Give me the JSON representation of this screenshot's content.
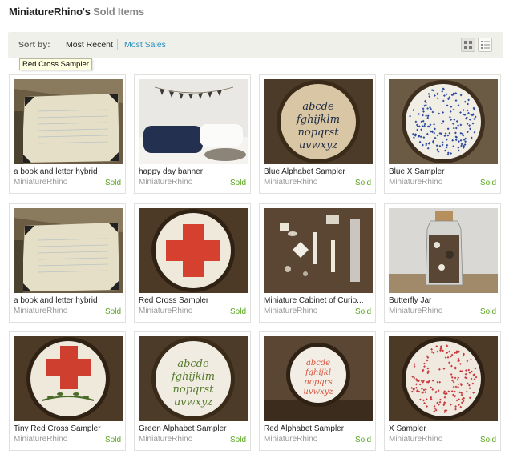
{
  "header": {
    "shop_name": "MiniatureRhino's",
    "suffix": "Sold Items"
  },
  "sortbar": {
    "label": "Sort by:",
    "options": [
      "Most Recent",
      "Most Sales"
    ],
    "active": "Most Recent"
  },
  "tooltip": "Red Cross Sampler",
  "items": [
    {
      "title": "a book and letter hybrid",
      "shop": "MiniatureRhino",
      "status": "Sold",
      "image": "book"
    },
    {
      "title": "happy day banner",
      "shop": "MiniatureRhino",
      "status": "Sold",
      "image": "banner"
    },
    {
      "title": "Blue Alphabet Sampler",
      "shop": "MiniatureRhino",
      "status": "Sold",
      "image": "alphabet-white"
    },
    {
      "title": "Blue X Sampler",
      "shop": "MiniatureRhino",
      "status": "Sold",
      "image": "x-blue"
    },
    {
      "title": "a book and letter hybrid",
      "shop": "MiniatureRhino",
      "status": "Sold",
      "image": "book"
    },
    {
      "title": "Red Cross Sampler",
      "shop": "MiniatureRhino",
      "status": "Sold",
      "image": "cross"
    },
    {
      "title": "Miniature Cabinet of Curio...",
      "shop": "MiniatureRhino",
      "status": "Sold",
      "image": "cabinet"
    },
    {
      "title": "Butterfly Jar",
      "shop": "MiniatureRhino",
      "status": "Sold",
      "image": "jar"
    },
    {
      "title": "Tiny Red Cross Sampler",
      "shop": "MiniatureRhino",
      "status": "Sold",
      "image": "cross-leaves"
    },
    {
      "title": "Green Alphabet Sampler",
      "shop": "MiniatureRhino",
      "status": "Sold",
      "image": "alphabet-green"
    },
    {
      "title": "Red Alphabet Sampler",
      "shop": "MiniatureRhino",
      "status": "Sold",
      "image": "alphabet-red"
    },
    {
      "title": "X Sampler",
      "shop": "MiniatureRhino",
      "status": "Sold",
      "image": "x-red"
    }
  ]
}
